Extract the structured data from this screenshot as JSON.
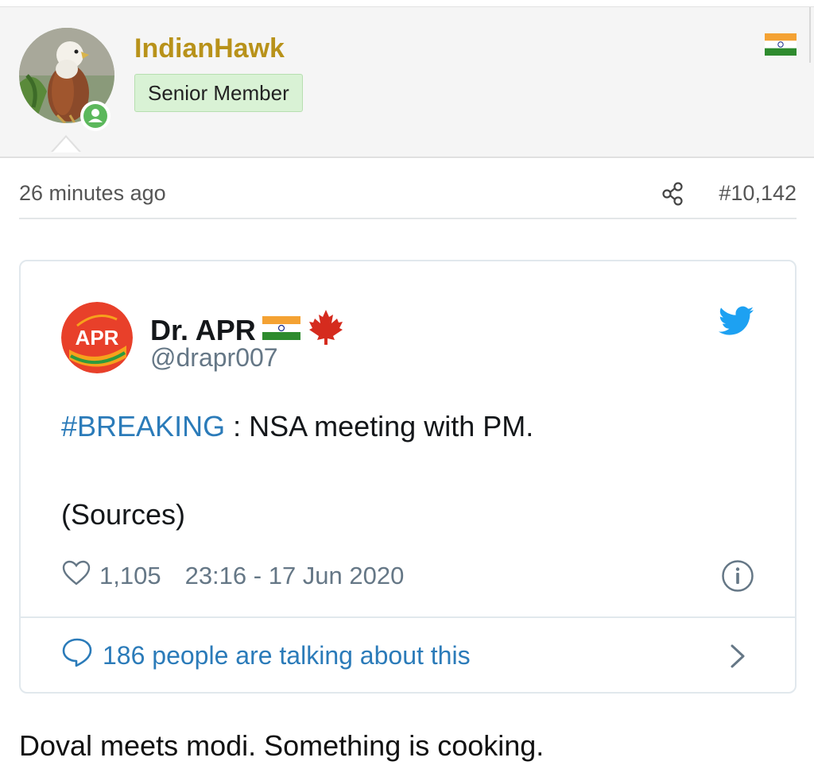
{
  "user": {
    "name": "IndianHawk",
    "rank": "Senior Member",
    "country_flag": "india-flag-icon"
  },
  "post": {
    "time": "26 minutes ago",
    "number": "#10,142",
    "body": "Doval meets modi. Something is cooking."
  },
  "tweet": {
    "author_name": "Dr. APR",
    "handle": "@drapr007",
    "avatar_text": "APR",
    "hashtag": "#BREAKING",
    "text": " : NSA meeting with PM.",
    "sources": "(Sources)",
    "likes": "1,105",
    "timestamp": "23:16 - 17 Jun 2020",
    "talking": "186 people are talking about this"
  },
  "colors": {
    "username": "#b8921a",
    "rank_badge_bg": "#d9f2d5",
    "twitter_blue": "#1da1f2",
    "link_blue": "#2b7bb9",
    "online_green": "#5cb85c"
  }
}
